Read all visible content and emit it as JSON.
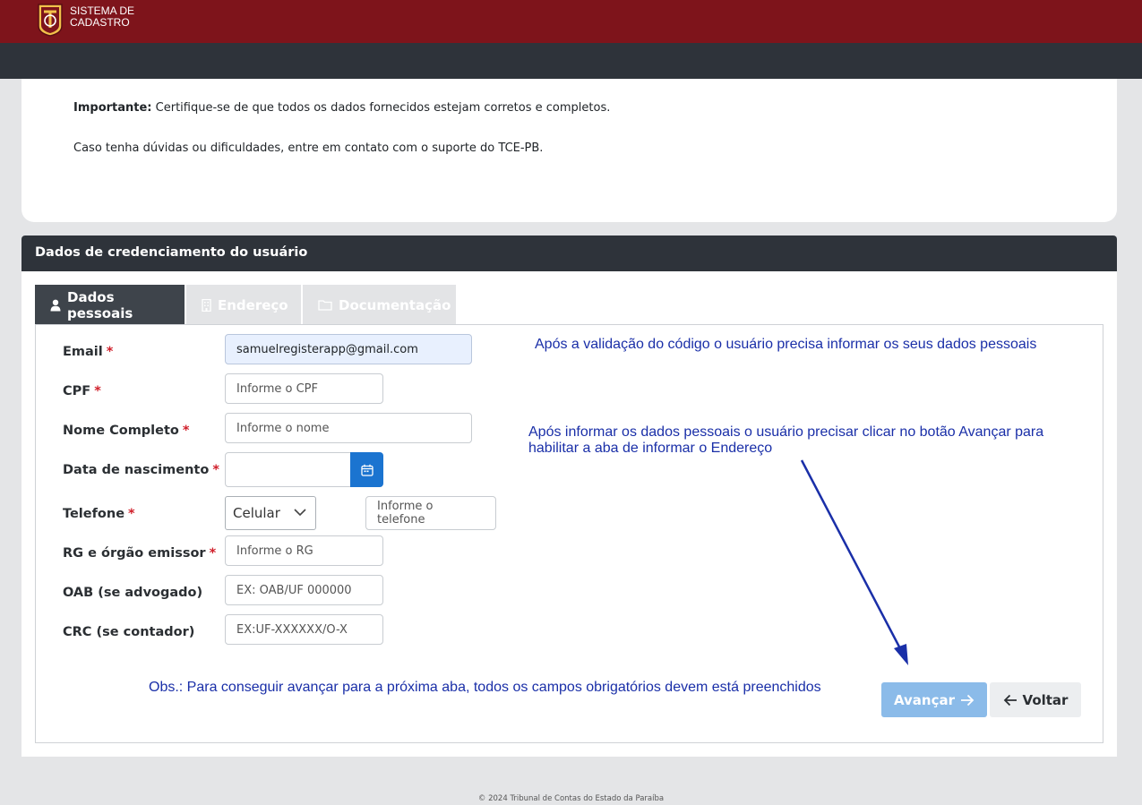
{
  "header": {
    "brand_line1": "SISTEMA DE",
    "brand_line2": "CADASTRO",
    "brand_color": "#7e141b"
  },
  "info": {
    "important_label": "Importante:",
    "important_text": "Certifique-se de que todos os dados fornecidos estejam corretos e completos.",
    "support_text": "Caso tenha dúvidas ou dificuldades, entre em contato com o suporte do TCE-PB."
  },
  "card": {
    "title": "Dados de credenciamento do usuário"
  },
  "tabs": [
    {
      "label": "Dados pessoais",
      "icon": "user-icon",
      "active": true
    },
    {
      "label": "Endereço",
      "icon": "building-icon",
      "active": false
    },
    {
      "label": "Documentação",
      "icon": "folder-icon",
      "active": false
    }
  ],
  "form": {
    "required_marker": "*",
    "email": {
      "label": "Email",
      "value": "samuelregisterapp@gmail.com"
    },
    "cpf": {
      "label": "CPF",
      "placeholder": "Informe o CPF"
    },
    "nome": {
      "label": "Nome Completo",
      "placeholder": "Informe o nome"
    },
    "nascimento": {
      "label": "Data de nascimento",
      "value": ""
    },
    "telefone": {
      "label": "Telefone",
      "type_value": "Celular",
      "placeholder": "Informe o telefone"
    },
    "rg": {
      "label": "RG e órgão emissor",
      "placeholder": "Informe o RG"
    },
    "oab": {
      "label": "OAB (se advogado)",
      "placeholder": "EX: OAB/UF 000000"
    },
    "crc": {
      "label": "CRC (se contador)",
      "placeholder": "EX:UF-XXXXXX/O-X"
    }
  },
  "annotations": {
    "note1": "Após a validação do código o usuário precisa informar os seus dados pessoais",
    "note2_line1": "Após informar os dados pessoais o usuário precisar clicar no botão Avançar para",
    "note2_line2": "habilitar a aba de informar o Endereço",
    "obs": "Obs.: Para conseguir avançar para a próxima aba, todos os campos obrigatórios devem está preenchidos",
    "color": "#1a2fa8"
  },
  "buttons": {
    "next_label": "Avançar",
    "back_label": "Voltar"
  },
  "footer": {
    "text": "© 2024 Tribunal de Contas do Estado da Paraíba"
  }
}
